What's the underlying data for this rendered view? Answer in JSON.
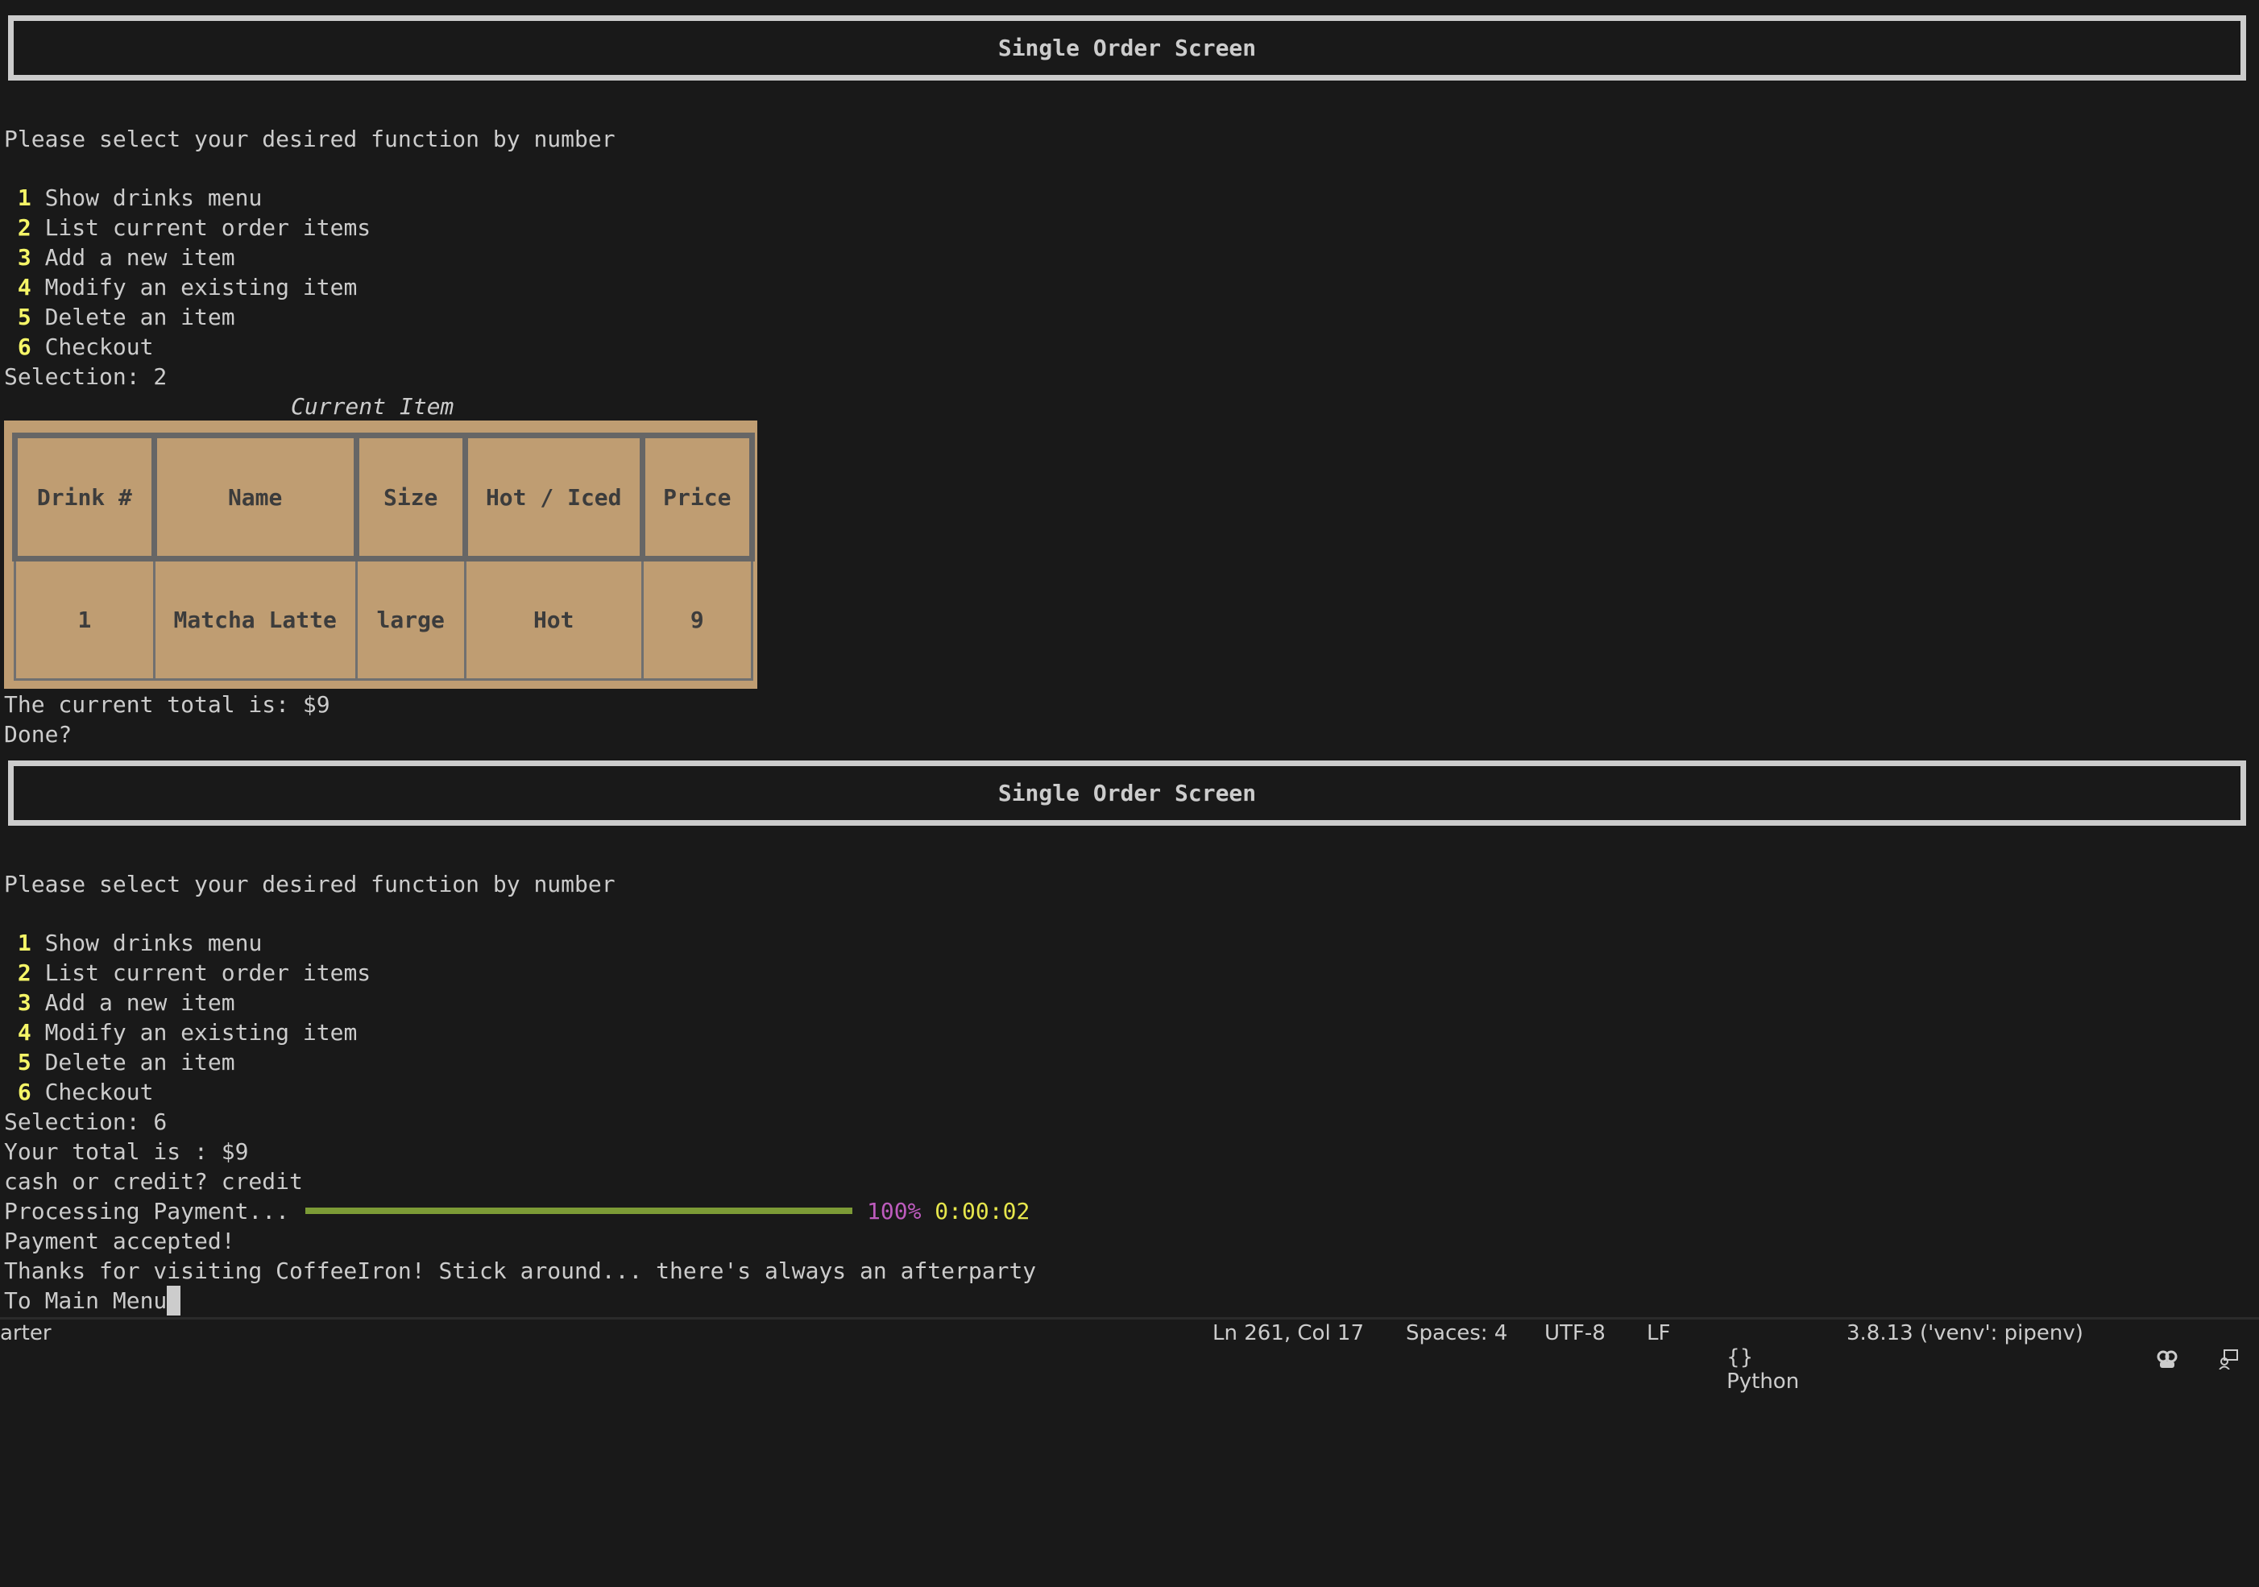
{
  "screen1": {
    "header_title": "Single Order Screen",
    "prompt": "Please select your desired function by number",
    "menu": [
      {
        "num": "1",
        "label": "Show drinks menu"
      },
      {
        "num": "2",
        "label": "List current order items"
      },
      {
        "num": "3",
        "label": "Add a new item"
      },
      {
        "num": "4",
        "label": "Modify an existing item"
      },
      {
        "num": "5",
        "label": "Delete an item"
      },
      {
        "num": "6",
        "label": "Checkout"
      }
    ],
    "selection": "Selection: 2",
    "table": {
      "caption": "Current Item",
      "headers": [
        "Drink #",
        "Name",
        "Size",
        "Hot / Iced",
        "Price"
      ],
      "rows": [
        [
          "1",
          "Matcha Latte",
          "large",
          "Hot",
          "9"
        ]
      ]
    },
    "current_total": "The current total is: $9",
    "done_prompt": "Done?"
  },
  "screen2": {
    "header_title": "Single Order Screen",
    "prompt": "Please select your desired function by number",
    "menu": [
      {
        "num": "1",
        "label": "Show drinks menu"
      },
      {
        "num": "2",
        "label": "List current order items"
      },
      {
        "num": "3",
        "label": "Add a new item"
      },
      {
        "num": "4",
        "label": "Modify an existing item"
      },
      {
        "num": "5",
        "label": "Delete an item"
      },
      {
        "num": "6",
        "label": "Checkout"
      }
    ],
    "selection": "Selection: 6",
    "total": "Your total is : $9",
    "payment_prompt": "cash or credit? credit",
    "progress": {
      "label": "Processing Payment...",
      "percent": 100,
      "percent_text": "100%",
      "elapsed": "0:00:02"
    },
    "payment_result": "Payment accepted!",
    "thanks": "Thanks for visiting CoffeeIron! Stick around... there's always an afterparty",
    "last_line": "To Main Menu"
  },
  "status_bar": {
    "left_text": "arter",
    "position": "Ln 261, Col 17",
    "spaces": "Spaces: 4",
    "encoding": "UTF-8",
    "eol": "LF",
    "language_icon": "braces-icon",
    "language": "Python",
    "interpreter": "3.8.13 ('venv': pipenv)"
  },
  "colors": {
    "background": "#191919",
    "text": "#cccccc",
    "menu_number": "#f5f567",
    "table_bg": "#bf9d72",
    "progress_bar": "#7c9b36",
    "percent": "#bd5bbd",
    "elapsed": "#e6e64c"
  }
}
